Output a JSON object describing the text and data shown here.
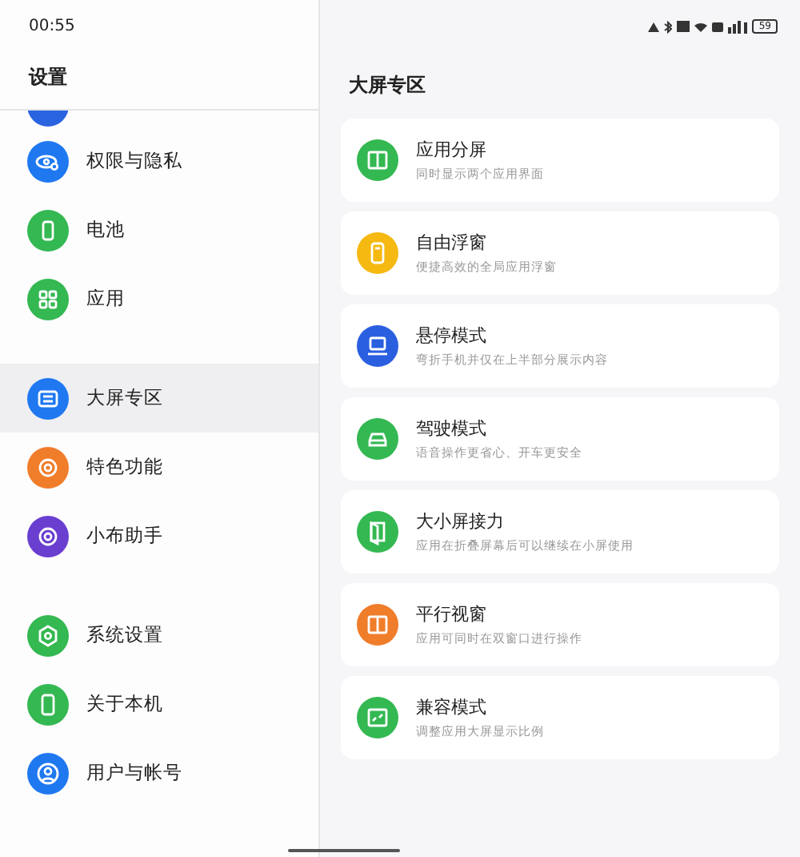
{
  "status_bar": {
    "time": "00:55",
    "battery": "59"
  },
  "sidebar": {
    "title": "设置",
    "cut_item": {
      "color": "#2a63e0"
    },
    "groups": [
      [
        {
          "label": "权限与隐私",
          "kind": "eye",
          "color": "#1f78f0",
          "selected": false
        },
        {
          "label": "电池",
          "kind": "battery",
          "color": "#34b852",
          "selected": false
        },
        {
          "label": "应用",
          "kind": "grid",
          "color": "#34b852",
          "selected": false
        }
      ],
      [
        {
          "label": "大屏专区",
          "kind": "sliders",
          "color": "#1f78f0",
          "selected": true
        },
        {
          "label": "特色功能",
          "kind": "ring",
          "color": "#f07d2a",
          "selected": false
        },
        {
          "label": "小布助手",
          "kind": "ring",
          "color": "#6a3fd0",
          "selected": false
        }
      ],
      [
        {
          "label": "系统设置",
          "kind": "hex",
          "color": "#34b852",
          "selected": false
        },
        {
          "label": "关于本机",
          "kind": "phone",
          "color": "#34b852",
          "selected": false
        },
        {
          "label": "用户与帐号",
          "kind": "user",
          "color": "#1f78f0",
          "selected": false
        }
      ]
    ]
  },
  "content": {
    "title": "大屏专区",
    "cards": [
      {
        "title": "应用分屏",
        "subtitle": "同时显示两个应用界面",
        "kind": "split",
        "color": "#34b852"
      },
      {
        "title": "自由浮窗",
        "subtitle": "便捷高效的全局应用浮窗",
        "kind": "phone",
        "color": "#f5b912"
      },
      {
        "title": "悬停模式",
        "subtitle": "弯折手机并仅在上半部分展示内容",
        "kind": "laptop",
        "color": "#2a5fe0"
      },
      {
        "title": "驾驶模式",
        "subtitle": "语音操作更省心、开车更安全",
        "kind": "car",
        "color": "#34b852"
      },
      {
        "title": "大小屏接力",
        "subtitle": "应用在折叠屏幕后可以继续在小屏使用",
        "kind": "door",
        "color": "#34b852"
      },
      {
        "title": "平行视窗",
        "subtitle": "应用可同时在双窗口进行操作",
        "kind": "split",
        "color": "#f07d2a"
      },
      {
        "title": "兼容模式",
        "subtitle": "调整应用大屏显示比例",
        "kind": "resize",
        "color": "#34b852"
      }
    ]
  }
}
